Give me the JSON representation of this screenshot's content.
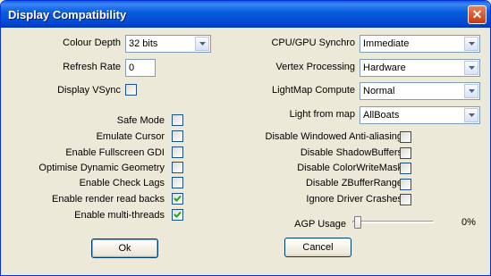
{
  "window": {
    "title": "Display Compatibility",
    "close_glyph": "✕",
    "close_icon": "close-icon"
  },
  "left": {
    "colour_depth": {
      "label": "Colour Depth",
      "value": "32 bits"
    },
    "refresh_rate": {
      "label": "Refresh Rate",
      "value": "0"
    },
    "vsync": {
      "label": "Display VSync",
      "checked": false
    },
    "options": [
      {
        "label": "Safe Mode",
        "checked": false
      },
      {
        "label": "Emulate Cursor",
        "checked": false
      },
      {
        "label": "Enable Fullscreen GDI",
        "checked": false
      },
      {
        "label": "Optimise Dynamic Geometry",
        "checked": false
      },
      {
        "label": "Enable Check Lags",
        "checked": false
      },
      {
        "label": "Enable render read backs",
        "checked": true
      },
      {
        "label": "Enable multi-threads",
        "checked": true
      }
    ]
  },
  "right": {
    "cpu_gpu_synchro": {
      "label": "CPU/GPU Synchro",
      "value": "Immediate"
    },
    "vertex_processing": {
      "label": "Vertex Processing",
      "value": "Hardware"
    },
    "lightmap_compute": {
      "label": "LightMap Compute",
      "value": "Normal"
    },
    "light_from_map": {
      "label": "Light from map",
      "value": "AllBoats"
    },
    "options": [
      {
        "label": "Disable Windowed Anti-aliasing",
        "checked": false
      },
      {
        "label": "Disable ShadowBuffers",
        "checked": false
      },
      {
        "label": "Disable ColorWriteMask",
        "checked": false
      },
      {
        "label": "Disable ZBufferRange",
        "checked": false
      },
      {
        "label": "Ignore Driver Crashes",
        "checked": false
      }
    ],
    "agp_usage": {
      "label": "AGP Usage",
      "value_text": "0%",
      "level_percent": 0
    }
  },
  "buttons": {
    "ok": "Ok",
    "cancel": "Cancel"
  },
  "colors": {
    "title_bar": "#0a5fe0",
    "face": "#ece9d8",
    "check": "#21a121"
  }
}
